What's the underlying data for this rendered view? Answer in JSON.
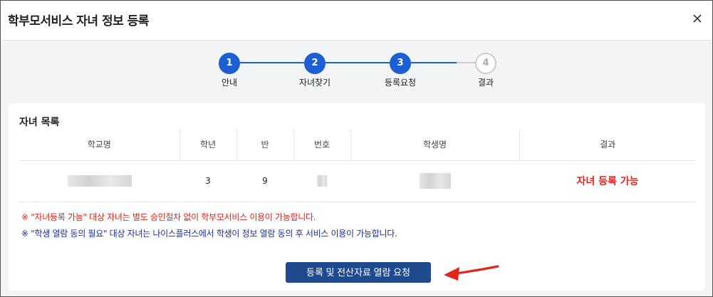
{
  "dialog": {
    "title": "학부모서비스 자녀 정보 등록",
    "close_icon": "close-icon"
  },
  "stepper": {
    "steps": [
      {
        "number": "1",
        "label": "안내",
        "state": "complete"
      },
      {
        "number": "2",
        "label": "자녀찾기",
        "state": "complete"
      },
      {
        "number": "3",
        "label": "등록요청",
        "state": "current"
      },
      {
        "number": "4",
        "label": "결과",
        "state": "upcoming"
      }
    ],
    "active_color": "#1c5fd4",
    "inactive_color": "#cccccc"
  },
  "children_list": {
    "title": "자녀 목록",
    "columns": [
      "학교명",
      "학년",
      "반",
      "번호",
      "학생명",
      "결과"
    ],
    "rows": [
      {
        "school": "",
        "grade": "3",
        "class": "9",
        "number": "",
        "name": "",
        "result": "자녀 등록 가능"
      }
    ],
    "result_color": "#e0261b"
  },
  "notes": [
    {
      "text": "※ \"자녀등록 가능\" 대상 자녀는 별도 승인절차 없이 학부모서비스 이용이 가능합니다.",
      "color": "#d8261b"
    },
    {
      "text": "※ \"학생 열람 동의 필요\" 대상 자녀는 나이스플러스에서 학생이 정보 열람 동의 후 서비스 이용이 가능합니다.",
      "color": "#1a2e9e"
    }
  ],
  "actions": {
    "request_label": "등록 및 전산자료 열람 요청",
    "button_color": "#1f4a8e",
    "arrow_icon": "red-arrow-icon"
  }
}
